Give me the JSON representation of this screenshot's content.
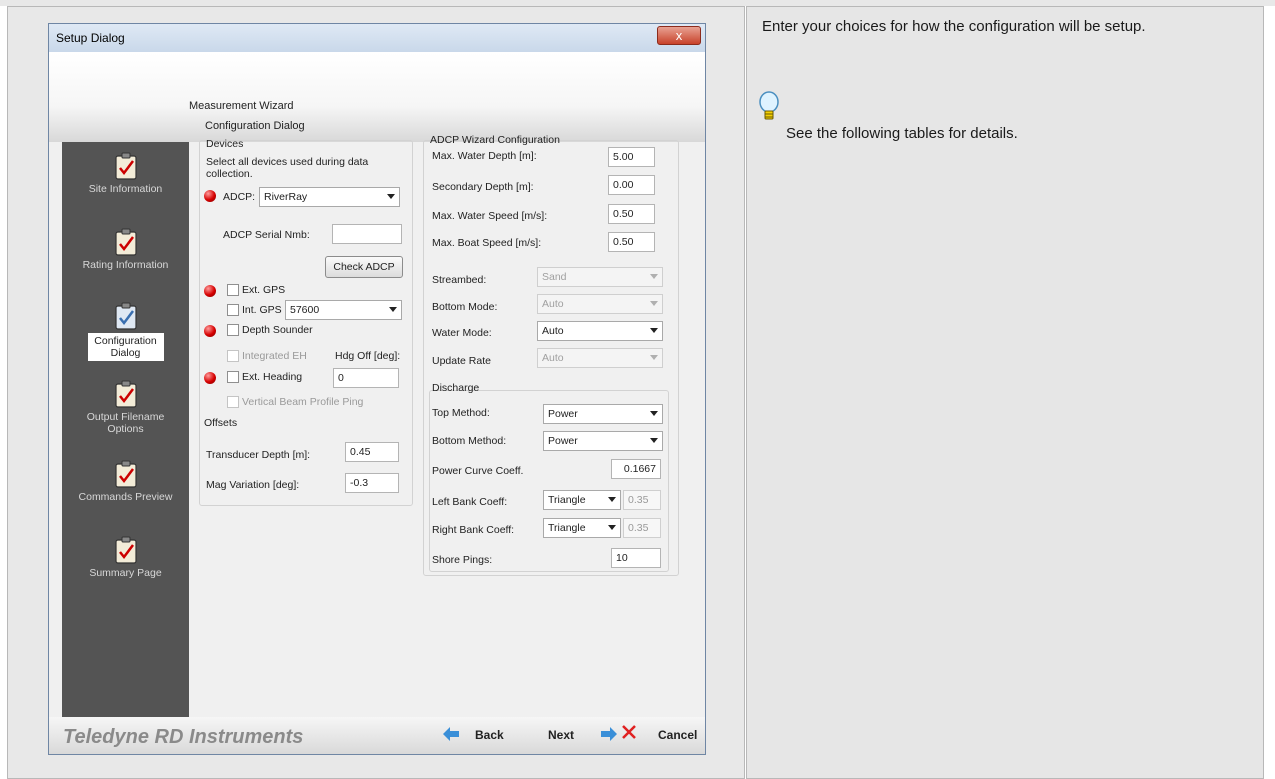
{
  "dialog": {
    "title": "Setup Dialog",
    "close_label": "x",
    "header_title": "Measurement Wizard",
    "header_subtitle": "Configuration Dialog"
  },
  "sidebar": {
    "items": [
      {
        "label": "Site Information",
        "selected": false
      },
      {
        "label": "Rating Information",
        "selected": false
      },
      {
        "label": "Configuration Dialog",
        "selected": true
      },
      {
        "label": "Output Filename Options",
        "selected": false
      },
      {
        "label": "Commands Preview",
        "selected": false
      },
      {
        "label": "Summary Page",
        "selected": false
      }
    ]
  },
  "devices": {
    "title": "Devices",
    "description": "Select all devices used during data collection.",
    "adcp_label": "ADCP:",
    "adcp_value": "RiverRay",
    "serial_label": "ADCP Serial Nmb:",
    "serial_value": "",
    "check_button": "Check ADCP",
    "ext_gps": "Ext. GPS",
    "int_gps": "Int. GPS",
    "baud_value": "57600",
    "depth_sounder": "Depth Sounder",
    "integrated_eh": "Integrated EH",
    "hdg_off_label": "Hdg Off [deg]:",
    "ext_heading": "Ext. Heading",
    "hdg_off_value": "0",
    "vertical_beam": "Vertical Beam Profile Ping"
  },
  "offsets": {
    "title": "Offsets",
    "transducer_label": "Transducer Depth [m]:",
    "transducer_value": "0.45",
    "mag_label": "Mag Variation [deg]:",
    "mag_value": "-0.3"
  },
  "adcp_config": {
    "title": "ADCP Wizard Configuration",
    "max_water_depth_label": "Max. Water Depth [m]:",
    "max_water_depth": "5.00",
    "secondary_depth_label": "Secondary Depth [m]:",
    "secondary_depth": "0.00",
    "max_water_speed_label": "Max. Water Speed [m/s]:",
    "max_water_speed": "0.50",
    "max_boat_speed_label": "Max. Boat Speed [m/s]:",
    "max_boat_speed": "0.50",
    "streambed_label": "Streambed:",
    "streambed": "Sand",
    "bottom_mode_label": "Bottom Mode:",
    "bottom_mode": "Auto",
    "water_mode_label": "Water Mode:",
    "water_mode": "Auto",
    "update_rate_label": "Update Rate",
    "update_rate": "Auto"
  },
  "discharge": {
    "title": "Discharge",
    "top_method_label": "Top Method:",
    "top_method": "Power",
    "bottom_method_label": "Bottom Method:",
    "bottom_method": "Power",
    "power_curve_label": "Power Curve Coeff.",
    "power_curve": "0.1667",
    "left_bank_label": "Left Bank Coeff:",
    "left_bank": "Triangle",
    "left_bank_value": "0.35",
    "right_bank_label": "Right Bank Coeff:",
    "right_bank": "Triangle",
    "right_bank_value": "0.35",
    "shore_pings_label": "Shore Pings:",
    "shore_pings": "10"
  },
  "footer": {
    "brand": "Teledyne RD Instruments",
    "back": "Back",
    "next": "Next",
    "cancel": "Cancel"
  },
  "help": {
    "instruction": "Enter your choices for how the configuration will be setup.",
    "tip": "See the following tables for details."
  },
  "colors": {
    "status_led": "#d60000",
    "sidebar_bg": "#545454",
    "nav_arrow": "#3a8fd8",
    "cancel_x": "#e02020"
  }
}
